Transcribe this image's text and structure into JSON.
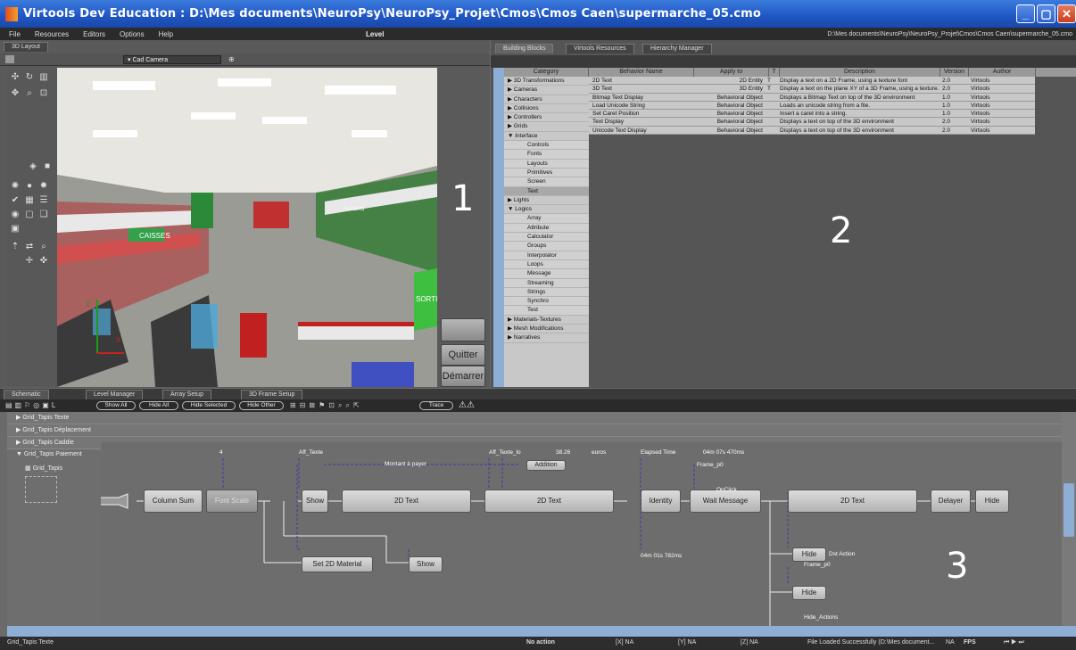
{
  "window": {
    "title": "Virtools Dev Education : D:\\Mes documents\\NeuroPsy\\NeuroPsy_Projet\\Cmos\\Cmos Caen\\supermarche_05.cmo",
    "minimize": "_",
    "maximize": "▢",
    "close": "✕"
  },
  "menu": {
    "items": [
      "File",
      "Resources",
      "Editors",
      "Options",
      "Help"
    ],
    "center_label": "Level",
    "path": "D:\\Mes documents\\NeuroPsy\\NeuroPsy_Projet\\Cmos\\Cmos Caen\\supermarche_05.cmo"
  },
  "layout": {
    "tab": "3D Layout",
    "camera_dropdown": "Cad Camera",
    "panel_number": "1",
    "buttons": {
      "quit": "Quitter",
      "start": "Démarrer"
    },
    "scene_texts": {
      "caisses": "CAISSES",
      "sortie": "SORTIE",
      "flashs": "FLASHS"
    },
    "axis_labels": {
      "y": "Y",
      "x": "X"
    }
  },
  "building_blocks": {
    "tabs": [
      "Building Blocks",
      "Virtools Resources",
      "Hierarchy Manager"
    ],
    "panel_number": "2",
    "columns": [
      "Category",
      "Behavior Name",
      "Apply to",
      "T",
      "Description",
      "Version",
      "Author"
    ],
    "categories": [
      {
        "label": "▶ 3D Transformations",
        "sub": false
      },
      {
        "label": "▶ Cameras",
        "sub": false
      },
      {
        "label": "▶ Characters",
        "sub": false
      },
      {
        "label": "▶ Collisions",
        "sub": false
      },
      {
        "label": "▶ Controllers",
        "sub": false
      },
      {
        "label": "▶ Grids",
        "sub": false
      },
      {
        "label": "▼ Interface",
        "sub": false
      },
      {
        "label": "Controls",
        "sub": true
      },
      {
        "label": "Fonts",
        "sub": true
      },
      {
        "label": "Layouts",
        "sub": true
      },
      {
        "label": "Primitives",
        "sub": true
      },
      {
        "label": "Screen",
        "sub": true
      },
      {
        "label": "Text",
        "sub": true,
        "selected": true
      },
      {
        "label": "▶ Lights",
        "sub": false
      },
      {
        "label": "▼ Logics",
        "sub": false
      },
      {
        "label": "Array",
        "sub": true
      },
      {
        "label": "Attribute",
        "sub": true
      },
      {
        "label": "Calculator",
        "sub": true
      },
      {
        "label": "Groups",
        "sub": true
      },
      {
        "label": "Interpolator",
        "sub": true
      },
      {
        "label": "Loops",
        "sub": true
      },
      {
        "label": "Message",
        "sub": true
      },
      {
        "label": "Streaming",
        "sub": true
      },
      {
        "label": "Strings",
        "sub": true
      },
      {
        "label": "Synchro",
        "sub": true
      },
      {
        "label": "Test",
        "sub": true
      },
      {
        "label": "▶ Materials-Textures",
        "sub": false
      },
      {
        "label": "▶ Mesh Modifications",
        "sub": false
      },
      {
        "label": "▶ Narratives",
        "sub": false
      }
    ],
    "behaviors": [
      {
        "name": "2D Text",
        "apply": "2D Entity",
        "t": "T",
        "desc": "Display a text on a 2D Frame, using a texture font",
        "version": "2.0",
        "author": "Virtools"
      },
      {
        "name": "3D Text",
        "apply": "3D Entity",
        "t": "T",
        "desc": "Display a text on the plane XY of a 3D Frame, using a texture.",
        "version": "2.0",
        "author": "Virtools"
      },
      {
        "name": "Bitmap Text Display",
        "apply": "Behavioral Object",
        "t": "",
        "desc": "Displays a Bitmap Text on top of the 3D environment",
        "version": "1.0",
        "author": "Virtools"
      },
      {
        "name": "Load Unicode String",
        "apply": "Behavioral Object",
        "t": "",
        "desc": "Loads an unicode string from a file.",
        "version": "1.0",
        "author": "Virtools"
      },
      {
        "name": "Set Caret Position",
        "apply": "Behavioral Object",
        "t": "",
        "desc": "Insert a caret into a string.",
        "version": "1.0",
        "author": "Virtools"
      },
      {
        "name": "Text Display",
        "apply": "Behavioral Object",
        "t": "",
        "desc": "Displays a text on top of the 3D environment",
        "version": "2.0",
        "author": "Virtools"
      },
      {
        "name": "Unicode Text Display",
        "apply": "Behavioral Object",
        "t": "",
        "desc": "Displays a text on top of the 3D environment",
        "version": "2.0",
        "author": "Virtools"
      }
    ]
  },
  "schematic": {
    "tabs": [
      "Schematic",
      "Level Manager",
      "Array Setup",
      "3D Frame Setup"
    ],
    "toolbar": {
      "show_all": "Show All",
      "hide_all": "Hide All",
      "hide_selected": "Hide Selected",
      "hide_other": "Hide Other",
      "trace": "Trace"
    },
    "panel_number": "3",
    "scripts": [
      "Grid_Tapis Texte",
      "Grid_Tapis Déplacement",
      "Grid_Tapis Caddie",
      "▼ Grid_Tapis Paiement"
    ],
    "sub_script": "Grid_Tapis",
    "blocks": {
      "column_sum": "Column Sum",
      "font_scale": "Font Scale",
      "show1": "Show",
      "text1": "2D Text",
      "text2": "2D Text",
      "identity": "Identity",
      "wait_message": "Wait Message",
      "text3": "2D Text",
      "delayer": "Delayer",
      "hide1": "Hide",
      "set_material": "Set 2D Material",
      "show2": "Show",
      "hide2": "Hide",
      "hide3": "Hide",
      "addition": "Addition"
    },
    "params": {
      "p4": "4",
      "aff_texte": "Aff_Texte",
      "aff_texte_lo": "Aff_Texte_lo",
      "montant": "Montant à payer",
      "value": "38.26",
      "euros": "euros",
      "elapsed": "Elapsed Time",
      "elapsed_val": "04m 07s 470ms",
      "frame_p0": "Frame_p0",
      "onclick": "OnClick",
      "time2": "04m 01s 782ms",
      "dst_action": "Dst Action",
      "frame_p0_2": "Frame_p0",
      "hide_actions": "Hide_Actions"
    }
  },
  "status": {
    "left": "Grid_Tapis Texte",
    "action": "No action",
    "x": "NA",
    "y": "NA",
    "z": "NA",
    "message": "File Loaded Successfully (D:\\Mes document...",
    "na": "NA",
    "fps": "FPS"
  }
}
